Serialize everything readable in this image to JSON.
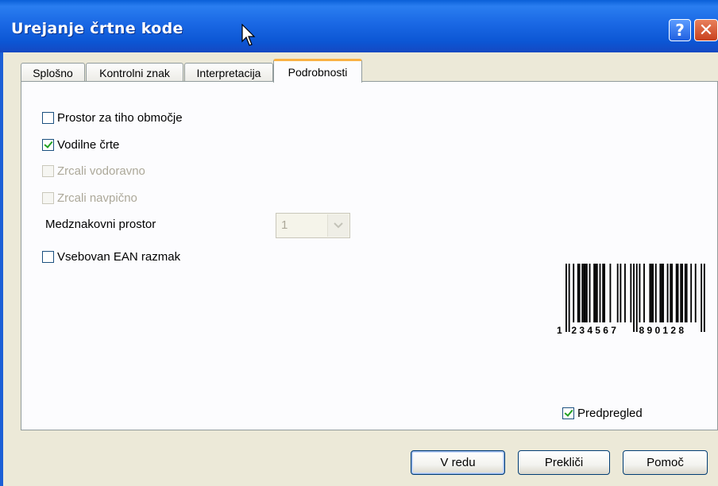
{
  "window": {
    "title": "Urejanje črtne kode"
  },
  "titlebar_buttons": {
    "help": "?",
    "close": "✕"
  },
  "tabs": [
    {
      "label": "Splošno",
      "active": false
    },
    {
      "label": "Kontrolni znak",
      "active": false
    },
    {
      "label": "Interpretacija",
      "active": false
    },
    {
      "label": "Podrobnosti",
      "active": true
    }
  ],
  "options": {
    "quiet_zone": {
      "label": "Prostor za tiho območje",
      "checked": false,
      "enabled": true
    },
    "guard_bars": {
      "label": "Vodilne črte",
      "checked": true,
      "enabled": true
    },
    "mirror_horizontal": {
      "label": "Zrcali vodoravno",
      "checked": false,
      "enabled": false
    },
    "mirror_vertical": {
      "label": "Zrcali navpično",
      "checked": false,
      "enabled": false
    },
    "intercharacter_gap_label": "Medznakovni prostor",
    "intercharacter_gap_value": "1",
    "ean_gap": {
      "label": "Vsebovan EAN razmak",
      "checked": false,
      "enabled": true
    }
  },
  "preview": {
    "barcode_text": "1234567890128",
    "first_digit": "1",
    "left_group": "234567",
    "right_group": "890128",
    "checkbox": {
      "label": "Predpregled",
      "checked": true
    }
  },
  "buttons": {
    "ok": "V redu",
    "cancel": "Prekliči",
    "help": "Pomoč"
  },
  "icons": {
    "cursor": "mouse-pointer-icon",
    "dropdown": "chevron-down-icon"
  }
}
